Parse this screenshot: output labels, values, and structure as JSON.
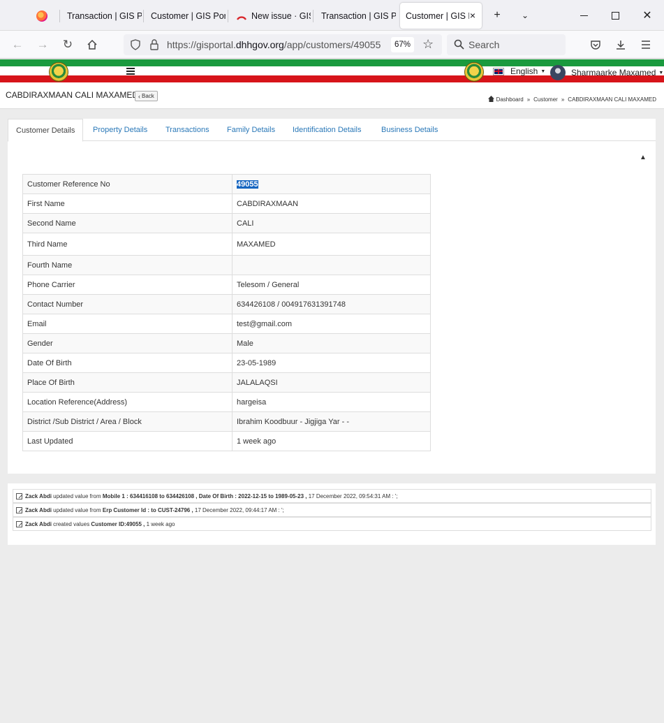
{
  "browser": {
    "tabs": [
      {
        "label": ""
      },
      {
        "label": "Transaction | GIS Po"
      },
      {
        "label": "Customer | GIS Por"
      },
      {
        "label": "New issue · GIS"
      },
      {
        "label": "Transaction | GIS Po"
      },
      {
        "label": "Customer | GIS P"
      }
    ],
    "url_prefix": "https://gisportal.",
    "url_domain": "dhhgov.org",
    "url_path": "/app/customers/49055",
    "zoom": "67%",
    "search_placeholder": "Search"
  },
  "header": {
    "language": "English",
    "user_name": "Sharmaarke Maxamed"
  },
  "page": {
    "title": "CABDIRAXMAAN CALI MAXAMED",
    "back_label": "Back",
    "breadcrumb": [
      "Dashboard",
      "Customer",
      "CABDIRAXMAAN CALI MAXAMED"
    ]
  },
  "tabs": [
    "Customer Details",
    "Property Details",
    "Transactions",
    "Family Details",
    "Identification Details",
    "Business Details"
  ],
  "details": [
    {
      "label": "Customer Reference No",
      "value": "49055"
    },
    {
      "label": "First Name",
      "value": "CABDIRAXMAAN"
    },
    {
      "label": "Second Name",
      "value": "CALI"
    },
    {
      "label": "Third Name",
      "value": "MAXAMED"
    },
    {
      "label": "Fourth Name",
      "value": ""
    },
    {
      "label": "Phone Carrier",
      "value": "Telesom / General"
    },
    {
      "label": "Contact Number",
      "value": "634426108 / 004917631391748"
    },
    {
      "label": "Email",
      "value": "test@gmail.com"
    },
    {
      "label": "Gender",
      "value": "Male"
    },
    {
      "label": "Date Of Birth",
      "value": "23-05-1989"
    },
    {
      "label": "Place Of Birth",
      "value": "JALALAQSI"
    },
    {
      "label": "Location Reference(Address)",
      "value": "hargeisa"
    },
    {
      "label": "District /Sub District / Area / Block",
      "value": "Ibrahim Koodbuur - Jigjiga Yar - -"
    },
    {
      "label": "Last Updated",
      "value": "1 week ago"
    }
  ],
  "log": [
    {
      "user": "Zack Abdi",
      "action": " updated value from ",
      "detail": "Mobile 1 : 634416108 to 634426108 , Date Of Birth : 2022-12-15 to 1989-05-23 ,",
      "time": " 17 December 2022, 09:54:31 AM : ';"
    },
    {
      "user": "Zack Abdi",
      "action": " updated value from ",
      "detail": "Erp Customer Id : to CUST-24796 ,",
      "time": " 17 December 2022, 09:44:17 AM : ';"
    },
    {
      "user": "Zack Abdi",
      "action": " created values ",
      "detail": "Customer ID:49055 ,",
      "time": " 1 week ago"
    }
  ]
}
